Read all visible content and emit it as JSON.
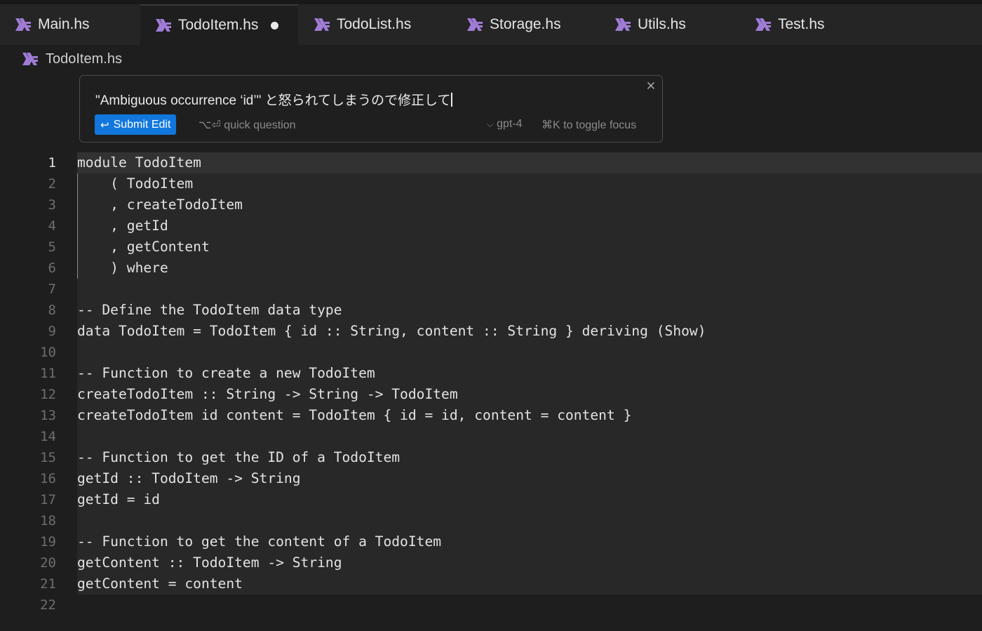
{
  "tabs": [
    {
      "label": "Main.hs",
      "icon": "haskell-icon",
      "active": false
    },
    {
      "label": "TodoItem.hs",
      "icon": "haskell-icon",
      "active": true,
      "modified": true
    },
    {
      "label": "TodoList.hs",
      "icon": "haskell-icon",
      "active": false
    },
    {
      "label": "Storage.hs",
      "icon": "haskell-icon",
      "active": false
    },
    {
      "label": "Utils.hs",
      "icon": "haskell-icon",
      "active": false
    },
    {
      "label": "Test.hs",
      "icon": "haskell-icon",
      "active": false
    }
  ],
  "breadcrumb": {
    "file": "TodoItem.hs",
    "icon": "haskell-icon"
  },
  "prompt": {
    "text": "\"Ambiguous occurrence ‘id’\" と怒られてしまうので修正して",
    "submit_label": "Submit Edit",
    "quick_label": "⌥⏎ quick question",
    "model": "gpt-4",
    "toggle_hint": "⌘K to toggle focus"
  },
  "editor": {
    "active_line": 1,
    "line_numbers": [
      "1",
      "2",
      "3",
      "4",
      "5",
      "6",
      "7",
      "8",
      "9",
      "10",
      "11",
      "12",
      "13",
      "14",
      "15",
      "16",
      "17",
      "18",
      "19",
      "20",
      "21",
      "22"
    ],
    "lines": [
      "module TodoItem",
      "    ( TodoItem",
      "    , createTodoItem",
      "    , getId",
      "    , getContent",
      "    ) where",
      "",
      "-- Define the TodoItem data type",
      "data TodoItem = TodoItem { id :: String, content :: String } deriving (Show)",
      "",
      "-- Function to create a new TodoItem",
      "createTodoItem :: String -> String -> TodoItem",
      "createTodoItem id content = TodoItem { id = id, content = content }",
      "",
      "-- Function to get the ID of a TodoItem",
      "getId :: TodoItem -> String",
      "getId = id",
      "",
      "-- Function to get the content of a TodoItem",
      "getContent :: TodoItem -> String",
      "getContent = content",
      ""
    ]
  },
  "colors": {
    "accent": "#1177dd",
    "haskell_icon": "#a07cd6",
    "background": "#1e1e1e"
  }
}
